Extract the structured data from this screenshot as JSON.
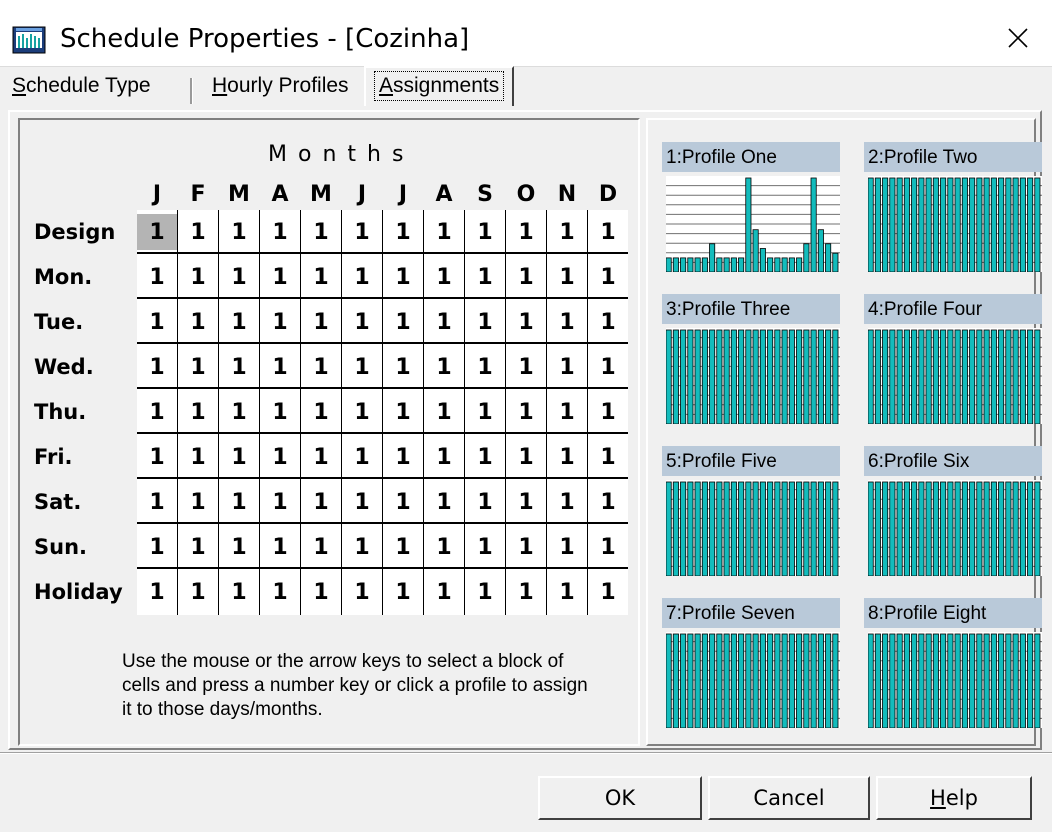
{
  "window": {
    "title": "Schedule Properties - [Cozinha]",
    "close_glyph": "✕"
  },
  "tabs": [
    {
      "hotkey": "S",
      "rest": "chedule Type",
      "active": false
    },
    {
      "hotkey": "H",
      "rest": "ourly Profiles",
      "active": false
    },
    {
      "hotkey": "A",
      "rest": "ssignments",
      "active": true
    }
  ],
  "assignments": {
    "months_title": "Months",
    "months": [
      "J",
      "F",
      "M",
      "A",
      "M",
      "J",
      "J",
      "A",
      "S",
      "O",
      "N",
      "D"
    ],
    "rows": [
      {
        "label": "Design",
        "values": [
          "1",
          "1",
          "1",
          "1",
          "1",
          "1",
          "1",
          "1",
          "1",
          "1",
          "1",
          "1"
        ]
      },
      {
        "label": "Mon.",
        "values": [
          "1",
          "1",
          "1",
          "1",
          "1",
          "1",
          "1",
          "1",
          "1",
          "1",
          "1",
          "1"
        ]
      },
      {
        "label": "Tue.",
        "values": [
          "1",
          "1",
          "1",
          "1",
          "1",
          "1",
          "1",
          "1",
          "1",
          "1",
          "1",
          "1"
        ]
      },
      {
        "label": "Wed.",
        "values": [
          "1",
          "1",
          "1",
          "1",
          "1",
          "1",
          "1",
          "1",
          "1",
          "1",
          "1",
          "1"
        ]
      },
      {
        "label": "Thu.",
        "values": [
          "1",
          "1",
          "1",
          "1",
          "1",
          "1",
          "1",
          "1",
          "1",
          "1",
          "1",
          "1"
        ]
      },
      {
        "label": "Fri.",
        "values": [
          "1",
          "1",
          "1",
          "1",
          "1",
          "1",
          "1",
          "1",
          "1",
          "1",
          "1",
          "1"
        ]
      },
      {
        "label": "Sat.",
        "values": [
          "1",
          "1",
          "1",
          "1",
          "1",
          "1",
          "1",
          "1",
          "1",
          "1",
          "1",
          "1"
        ]
      },
      {
        "label": "Sun.",
        "values": [
          "1",
          "1",
          "1",
          "1",
          "1",
          "1",
          "1",
          "1",
          "1",
          "1",
          "1",
          "1"
        ]
      },
      {
        "label": "Holiday",
        "values": [
          "1",
          "1",
          "1",
          "1",
          "1",
          "1",
          "1",
          "1",
          "1",
          "1",
          "1",
          "1"
        ]
      }
    ],
    "selected_cell": {
      "row": 0,
      "col": 0
    },
    "help_text": "Use the mouse or the arrow keys to select a block of cells and press a number key or click a profile to assign it to those days/months."
  },
  "profiles": [
    {
      "label": "1:Profile One",
      "levels": [
        0.15,
        0.15,
        0.15,
        0.15,
        0.15,
        0.15,
        0.3,
        0.15,
        0.15,
        0.15,
        0.15,
        1.0,
        0.45,
        0.25,
        0.15,
        0.15,
        0.15,
        0.15,
        0.15,
        0.3,
        1.0,
        0.45,
        0.3,
        0.2
      ]
    },
    {
      "label": "2:Profile Two",
      "levels": [
        1,
        1,
        1,
        1,
        1,
        1,
        1,
        1,
        1,
        1,
        1,
        1,
        1,
        1,
        1,
        1,
        1,
        1,
        1,
        1,
        1,
        1,
        1,
        1
      ]
    },
    {
      "label": "3:Profile Three",
      "levels": [
        1,
        1,
        1,
        1,
        1,
        1,
        1,
        1,
        1,
        1,
        1,
        1,
        1,
        1,
        1,
        1,
        1,
        1,
        1,
        1,
        1,
        1,
        1,
        1
      ]
    },
    {
      "label": "4:Profile Four",
      "levels": [
        1,
        1,
        1,
        1,
        1,
        1,
        1,
        1,
        1,
        1,
        1,
        1,
        1,
        1,
        1,
        1,
        1,
        1,
        1,
        1,
        1,
        1,
        1,
        1
      ]
    },
    {
      "label": "5:Profile Five",
      "levels": [
        1,
        1,
        1,
        1,
        1,
        1,
        1,
        1,
        1,
        1,
        1,
        1,
        1,
        1,
        1,
        1,
        1,
        1,
        1,
        1,
        1,
        1,
        1,
        1
      ]
    },
    {
      "label": "6:Profile Six",
      "levels": [
        1,
        1,
        1,
        1,
        1,
        1,
        1,
        1,
        1,
        1,
        1,
        1,
        1,
        1,
        1,
        1,
        1,
        1,
        1,
        1,
        1,
        1,
        1,
        1
      ]
    },
    {
      "label": "7:Profile Seven",
      "levels": [
        1,
        1,
        1,
        1,
        1,
        1,
        1,
        1,
        1,
        1,
        1,
        1,
        1,
        1,
        1,
        1,
        1,
        1,
        1,
        1,
        1,
        1,
        1,
        1
      ]
    },
    {
      "label": "8:Profile Eight",
      "levels": [
        1,
        1,
        1,
        1,
        1,
        1,
        1,
        1,
        1,
        1,
        1,
        1,
        1,
        1,
        1,
        1,
        1,
        1,
        1,
        1,
        1,
        1,
        1,
        1
      ]
    }
  ],
  "buttons": {
    "ok": "OK",
    "cancel": "Cancel",
    "help_hotkey": "H",
    "help_rest": "elp"
  },
  "colors": {
    "bar_fill": "#13bcbc",
    "profile_title_bg": "#b9c9d9",
    "selected_cell": "#b4b4b4"
  },
  "icons": {
    "app": "schedule-app-icon",
    "close": "close-icon"
  }
}
